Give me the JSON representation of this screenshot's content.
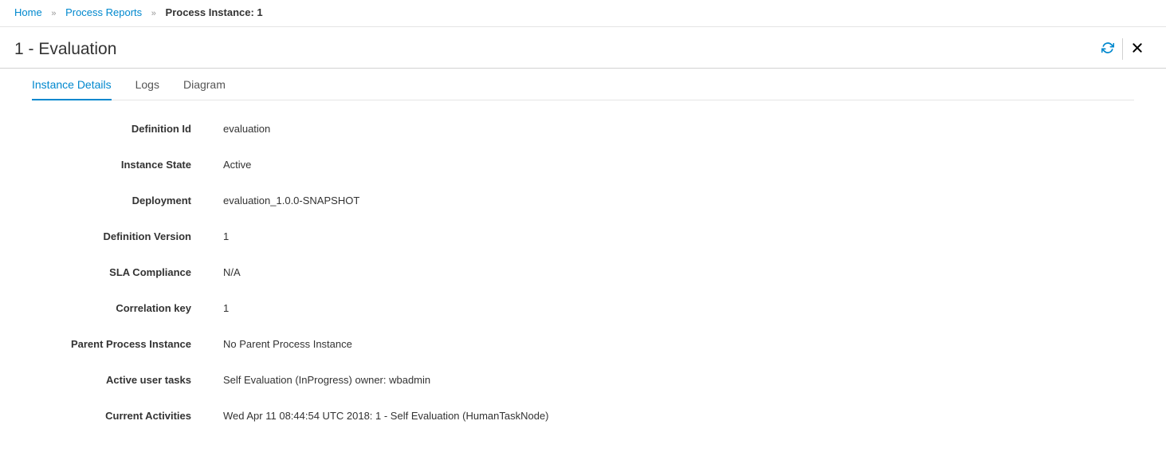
{
  "breadcrumb": {
    "home": "Home",
    "reports": "Process Reports",
    "current": "Process Instance: 1"
  },
  "header": {
    "title": "1 - Evaluation"
  },
  "tabs": {
    "instanceDetails": "Instance Details",
    "logs": "Logs",
    "diagram": "Diagram"
  },
  "details": {
    "definitionId": {
      "label": "Definition Id",
      "value": "evaluation"
    },
    "instanceState": {
      "label": "Instance State",
      "value": "Active"
    },
    "deployment": {
      "label": "Deployment",
      "value": "evaluation_1.0.0-SNAPSHOT"
    },
    "definitionVersion": {
      "label": "Definition Version",
      "value": "1"
    },
    "slaCompliance": {
      "label": "SLA Compliance",
      "value": "N/A"
    },
    "correlationKey": {
      "label": "Correlation key",
      "value": "1"
    },
    "parentProcessInstance": {
      "label": "Parent Process Instance",
      "value": "No Parent Process Instance"
    },
    "activeUserTasks": {
      "label": "Active user tasks",
      "value": "Self Evaluation (InProgress) owner: wbadmin"
    },
    "currentActivities": {
      "label": "Current Activities",
      "value": "Wed Apr 11 08:44:54 UTC 2018: 1 - Self Evaluation (HumanTaskNode)"
    }
  }
}
